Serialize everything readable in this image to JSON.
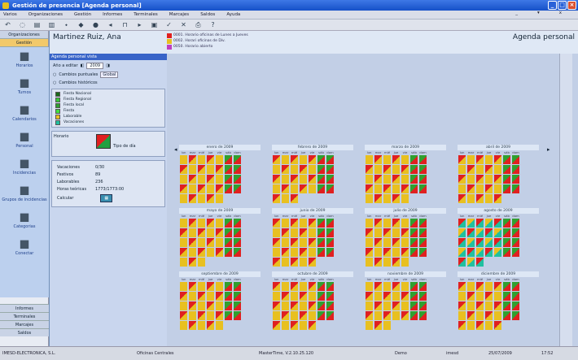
{
  "window": {
    "title": "Gestión de presencia  [Agenda personal]"
  },
  "menu": [
    "Varios",
    "Organizaciones",
    "Gestión",
    "Informes",
    "Terminales",
    "Marcajes",
    "Saldos",
    "Ayuda"
  ],
  "menu_right": [
    "_",
    "▾",
    "x"
  ],
  "toolbar": [
    "↶",
    "◌",
    "▤",
    "▥",
    "⬩",
    "◆",
    "●",
    "◂",
    "⊓",
    "▸",
    "▣",
    "✓",
    "✕",
    "⎙",
    "?"
  ],
  "left": {
    "tabs": [
      "Organizaciones",
      "Gestión"
    ],
    "nav": [
      {
        "label": "Horarios",
        "icon": "clock-icon"
      },
      {
        "label": "Turnos",
        "icon": "shifts-icon"
      },
      {
        "label": "Calendarios",
        "icon": "calendar-icon"
      },
      {
        "label": "Personal",
        "icon": "person-icon"
      },
      {
        "label": "Incidencias",
        "icon": "incident-icon"
      },
      {
        "label": "Grupos de incidencias",
        "icon": "group-icon"
      },
      {
        "label": "Categorias",
        "icon": "category-icon"
      },
      {
        "label": "Conectar",
        "icon": "connect-icon"
      }
    ],
    "bottom": [
      "Informes",
      "Terminales",
      "Marcajes",
      "Saldos"
    ]
  },
  "header": {
    "name": "Martinez Ruiz, Ana",
    "page": "Agenda personal"
  },
  "legend_top": [
    {
      "label": "0001. Horario oficinas de Lunes a Jueves",
      "color": "#e02020"
    },
    {
      "label": "0002. Horari oficinas de Div.",
      "color": "#e8c020"
    },
    {
      "label": "0050. Horario abierto",
      "color": "#c040c0"
    }
  ],
  "panel": {
    "title": "Agenda personal vista",
    "year_label": "Año a editar",
    "year": "2009",
    "radio1": "Cambios puntuales",
    "radio1b": "Global",
    "radio2": "Cambios históricos",
    "tipos": [
      {
        "label": "Fiesta Nacional",
        "color": "#1a6a1a"
      },
      {
        "label": "Fiesta Regional",
        "color": "#38c838"
      },
      {
        "label": "Fiesta local",
        "color": "#30a030"
      },
      {
        "label": "Fiesta",
        "color": "#40e040"
      },
      {
        "label": "Laborable",
        "color": "#e8c020"
      },
      {
        "label": "Vacaciones",
        "color": "#20c0a0"
      }
    ],
    "horario": "Horario",
    "tipo_dia": "Tipo de día",
    "stats": [
      [
        "Vacaciones",
        "0/30"
      ],
      [
        "Festivos",
        "89"
      ],
      [
        "Laborables",
        "236"
      ],
      [
        "Horas teóricas",
        "1773/1773:00"
      ]
    ],
    "calcular": "Calcular"
  },
  "days_header": [
    "lun",
    "mar",
    "mié",
    "jue",
    "vie",
    "sáb",
    "dom"
  ],
  "months": [
    "enero de 2009",
    "febrero de 2009",
    "marzo de 2009",
    "abril de 2009",
    "mayo de 2009",
    "junio de 2009",
    "julio de 2009",
    "agosto de 2009",
    "septiembre de 2009",
    "octubre de 2009",
    "noviembre de 2009",
    "diciembre de 2009"
  ],
  "jan_nums": [
    "29",
    "30",
    "31"
  ],
  "dec_nums": [
    "1",
    "2",
    "3",
    "4",
    "5",
    "6",
    "7",
    "8",
    "9",
    "10"
  ],
  "status": {
    "company": "IMESD-ELECTRONICA, S.L.",
    "site": "Oficinas Centrales",
    "version": "MasterTime, V.2.10.25.120",
    "user": "Demo",
    "db": "imesd",
    "date": "25/07/2009",
    "time": "17:52"
  }
}
